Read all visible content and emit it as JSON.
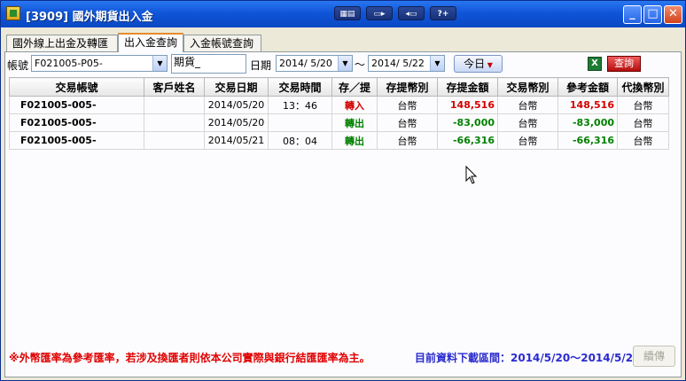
{
  "window": {
    "title": "[3909] 國外期貨出入金"
  },
  "tabs": [
    {
      "label": "國外線上出金及轉匯",
      "active": false
    },
    {
      "label": "出入金查詢",
      "active": true
    },
    {
      "label": "入金帳號查詢",
      "active": false
    }
  ],
  "filters": {
    "account_label": "帳號",
    "account_value": "F021005-P05-",
    "type_value": "期貨_",
    "date_label": "日期",
    "date_from": "2014/ 5/20",
    "date_sep": "～",
    "date_to": "2014/ 5/22",
    "today_label": "今日",
    "excel_icon": "excel-icon",
    "query_label": "查詢"
  },
  "table": {
    "columns": [
      "交易帳號",
      "客戶姓名",
      "交易日期",
      "交易時間",
      "存／提",
      "存提幣別",
      "存提金額",
      "交易幣別",
      "參考金額",
      "代換幣別"
    ],
    "rows": [
      [
        "F021005-005-",
        "",
        "2014/05/20",
        "13：46",
        "轉入",
        "台幣",
        "148,516",
        "台幣",
        "148,516",
        "台幣"
      ],
      [
        "F021005-005-",
        "",
        "2014/05/20",
        "",
        "轉出",
        "台幣",
        "-83,000",
        "台幣",
        "-83,000",
        "台幣"
      ],
      [
        "F021005-005-",
        "",
        "2014/05/21",
        "08：04",
        "轉出",
        "台幣",
        "-66,316",
        "台幣",
        "-66,316",
        "台幣"
      ]
    ]
  },
  "footer": {
    "note": "※外幣匯率為參考匯率，若涉及換匯者則依本公司實際與銀行結匯匯率為主。",
    "range_label": "目前資料下載區間：2014/5/20～2014/5/22",
    "continue_label": "續傳"
  },
  "colors": {
    "positive": "#d40000",
    "negative": "#008000",
    "accent": "#0f55d8"
  }
}
